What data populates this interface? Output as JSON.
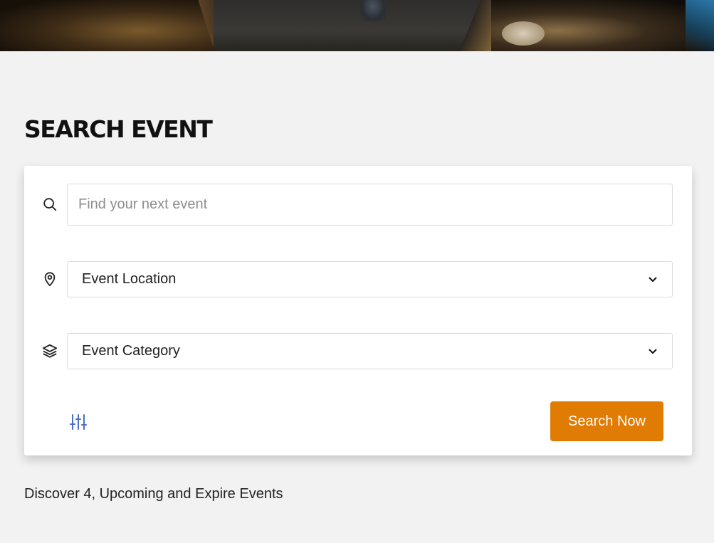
{
  "hero": {
    "image_icon": "conference-hall-image"
  },
  "search_section": {
    "title": "SEARCH EVENT",
    "keyword": {
      "icon": "search-icon",
      "value": "",
      "placeholder": "Find your next event"
    },
    "location": {
      "icon": "map-pin-icon",
      "selected": "Event Location"
    },
    "category": {
      "icon": "layers-icon",
      "selected": "Event Category"
    },
    "filter_icon": "sliders-icon",
    "submit_label": "Search Now",
    "submit_color": "#e07b04",
    "filter_color": "#4a6fc7"
  },
  "summary": {
    "text": "Discover 4, Upcoming and Expire Events"
  }
}
